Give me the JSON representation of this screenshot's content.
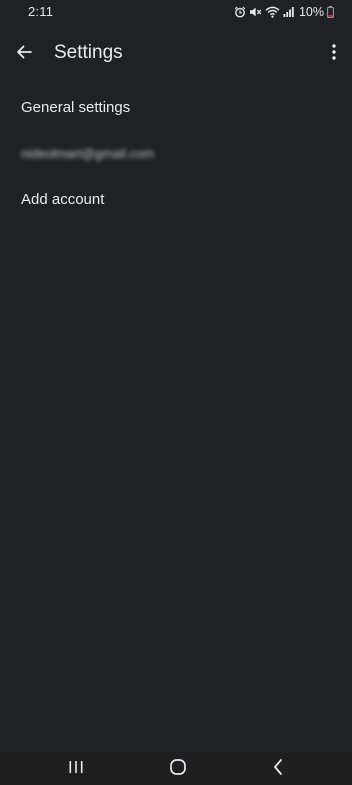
{
  "status_bar": {
    "time": "2:11",
    "battery_text": "10%",
    "icons": [
      "alarm-icon",
      "mute-icon",
      "wifi-icon",
      "signal-icon",
      "battery-icon"
    ],
    "battery_level_color": "#e53935"
  },
  "app_bar": {
    "title": "Settings",
    "back_icon": "arrow-back-icon",
    "overflow_icon": "more-vert-icon"
  },
  "settings_list": {
    "items": [
      {
        "label": "General settings"
      },
      {
        "label": "nideolmart@gmail.com",
        "note": "blurred"
      },
      {
        "label": "Add account"
      }
    ]
  },
  "nav_bar": {
    "buttons": [
      "recents-icon",
      "home-icon",
      "back-icon"
    ]
  },
  "colors": {
    "background": "#202124",
    "text": "#e8eaed"
  }
}
